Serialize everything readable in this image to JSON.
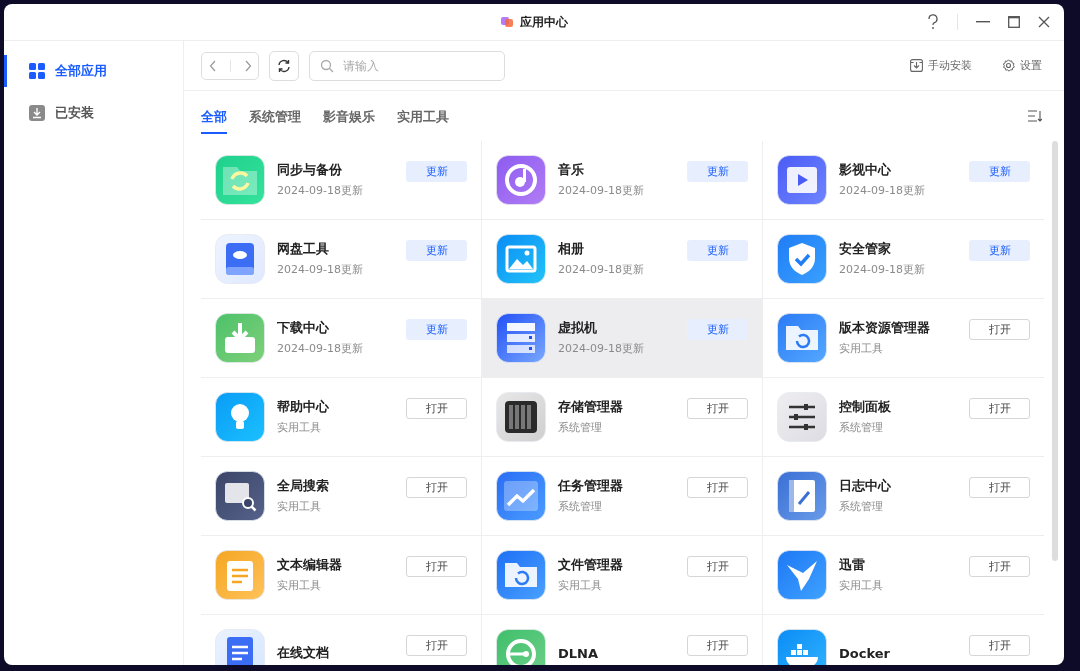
{
  "window": {
    "title": "应用中心"
  },
  "sidebar": {
    "items": [
      {
        "label": "全部应用",
        "selected": true
      },
      {
        "label": "已安装",
        "selected": false
      }
    ]
  },
  "toolbar": {
    "search": {
      "placeholder": "请输入"
    },
    "actions": [
      "手动安装",
      "设置"
    ]
  },
  "tabs": [
    {
      "label": "全部",
      "selected": true
    },
    {
      "label": "系统管理",
      "selected": false
    },
    {
      "label": "影音娱乐",
      "selected": false
    },
    {
      "label": "实用工具",
      "selected": false
    }
  ],
  "apps": [
    {
      "name": "同步与备份",
      "subtitle": "2024-09-18更新",
      "button": "更新",
      "kind": "update",
      "selected": false
    },
    {
      "name": "音乐",
      "subtitle": "2024-09-18更新",
      "button": "更新",
      "kind": "update",
      "selected": false
    },
    {
      "name": "影视中心",
      "subtitle": "2024-09-18更新",
      "button": "更新",
      "kind": "update",
      "selected": false
    },
    {
      "name": "网盘工具",
      "subtitle": "2024-09-18更新",
      "button": "更新",
      "kind": "update",
      "selected": false
    },
    {
      "name": "相册",
      "subtitle": "2024-09-18更新",
      "button": "更新",
      "kind": "update",
      "selected": false
    },
    {
      "name": "安全管家",
      "subtitle": "2024-09-18更新",
      "button": "更新",
      "kind": "update",
      "selected": false
    },
    {
      "name": "下载中心",
      "subtitle": "2024-09-18更新",
      "button": "更新",
      "kind": "update",
      "selected": false
    },
    {
      "name": "虚拟机",
      "subtitle": "2024-09-18更新",
      "button": "更新",
      "kind": "update",
      "selected": true
    },
    {
      "name": "版本资源管理器",
      "subtitle": "实用工具",
      "button": "打开",
      "kind": "open",
      "selected": false
    },
    {
      "name": "帮助中心",
      "subtitle": "实用工具",
      "button": "打开",
      "kind": "open",
      "selected": false
    },
    {
      "name": "存储管理器",
      "subtitle": "系统管理",
      "button": "打开",
      "kind": "open",
      "selected": false
    },
    {
      "name": "控制面板",
      "subtitle": "系统管理",
      "button": "打开",
      "kind": "open",
      "selected": false
    },
    {
      "name": "全局搜索",
      "subtitle": "实用工具",
      "button": "打开",
      "kind": "open",
      "selected": false
    },
    {
      "name": "任务管理器",
      "subtitle": "系统管理",
      "button": "打开",
      "kind": "open",
      "selected": false
    },
    {
      "name": "日志中心",
      "subtitle": "系统管理",
      "button": "打开",
      "kind": "open",
      "selected": false
    },
    {
      "name": "文本编辑器",
      "subtitle": "实用工具",
      "button": "打开",
      "kind": "open",
      "selected": false
    },
    {
      "name": "文件管理器",
      "subtitle": "实用工具",
      "button": "打开",
      "kind": "open",
      "selected": false
    },
    {
      "name": "迅雷",
      "subtitle": "实用工具",
      "button": "打开",
      "kind": "open",
      "selected": false
    },
    {
      "name": "在线文档",
      "button": "打开",
      "kind": "open",
      "selected": false
    },
    {
      "name": "DLNA",
      "button": "打开",
      "kind": "open",
      "selected": false
    },
    {
      "name": "Docker",
      "button": "打开",
      "kind": "open",
      "selected": false
    }
  ]
}
